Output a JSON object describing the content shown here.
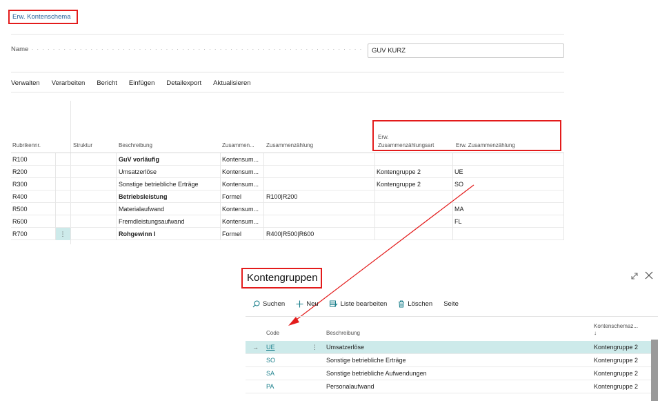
{
  "page": {
    "title": "Erw. Kontenschema",
    "name_label": "Name",
    "name_dots": "· · · · · · · · · · · · · · · · · · · · · · · · · · · · · · · · · · · · · · · · · · · · · · · · · · · · · · · · · · · · · · · · · · · · · · · · · · · · · · · · · · · · · · · · · · · · · · · · · · · · · · · · · · · ·",
    "name_value": "GUV KURZ"
  },
  "menu": [
    "Verwalten",
    "Verarbeiten",
    "Bericht",
    "Einfügen",
    "Detailexport",
    "Aktualisieren"
  ],
  "table": {
    "headers": {
      "rubrik": "Rubrikennr.",
      "struktur": "Struktur",
      "beschreibung": "Beschreibung",
      "zusammen_kurz": "Zusammen...",
      "zusammenzaehlung": "Zusammenzählung",
      "erw_art_1": "Erw.",
      "erw_art_2": "Zusammenzählungsart",
      "erw_zusammenzaehlung": "Erw. Zusammenzählung"
    },
    "rows": [
      {
        "rubrik": "R100",
        "beschreibung": "GuV vorläufig",
        "bold": true,
        "typ": "Kontensum...",
        "formel": "",
        "erw_art": "",
        "erw_zus": ""
      },
      {
        "rubrik": "R200",
        "beschreibung": "Umsatzerlöse",
        "bold": false,
        "typ": "Kontensum...",
        "formel": "",
        "erw_art": "Kontengruppe 2",
        "erw_zus": "UE"
      },
      {
        "rubrik": "R300",
        "beschreibung": "Sonstige betriebliche Erträge",
        "bold": false,
        "typ": "Kontensum...",
        "formel": "",
        "erw_art": "Kontengruppe 2",
        "erw_zus": "SO"
      },
      {
        "rubrik": "R400",
        "beschreibung": "Betriebsleistung",
        "bold": true,
        "typ": "Formel",
        "formel": "R100|R200",
        "erw_art": "",
        "erw_zus": ""
      },
      {
        "rubrik": "R500",
        "beschreibung": "Materialaufwand",
        "bold": false,
        "typ": "Kontensum...",
        "formel": "",
        "erw_art": "",
        "erw_zus": "MA"
      },
      {
        "rubrik": "R600",
        "beschreibung": "Fremdleistungsaufwand",
        "bold": false,
        "typ": "Kontensum...",
        "formel": "",
        "erw_art": "",
        "erw_zus": "FL"
      },
      {
        "rubrik": "R700",
        "beschreibung": "Rohgewinn I",
        "bold": true,
        "typ": "Formel",
        "formel": "R400|R500|R600",
        "erw_art": "",
        "erw_zus": "",
        "dots": "⋮"
      }
    ]
  },
  "subpage": {
    "title": "Kontengruppen",
    "toolbar": {
      "search": "Suchen",
      "new": "Neu",
      "edit_list": "Liste bearbeiten",
      "delete": "Löschen",
      "page": "Seite"
    },
    "headers": {
      "code": "Code",
      "beschreibung": "Beschreibung",
      "schema": "Kontenschemaz...",
      "sort": "↓"
    },
    "rows": [
      {
        "arrow": "→",
        "code": "UE",
        "dots": "⋮",
        "beschreibung": "Umsatzerlöse",
        "schema": "Kontengruppe 2"
      },
      {
        "code": "SO",
        "beschreibung": "Sonstige betriebliche Erträge",
        "schema": "Kontengruppe 2"
      },
      {
        "code": "SA",
        "beschreibung": "Sonstige betriebliche Aufwendungen",
        "schema": "Kontengruppe 2"
      },
      {
        "code": "PA",
        "beschreibung": "Personalaufwand",
        "schema": "Kontengruppe 2"
      }
    ]
  },
  "colors": {
    "highlight_red": "#e31b1b",
    "link_teal": "#1a7f8b",
    "selection_bg": "#cdeaea",
    "title_blue": "#215f9a"
  }
}
